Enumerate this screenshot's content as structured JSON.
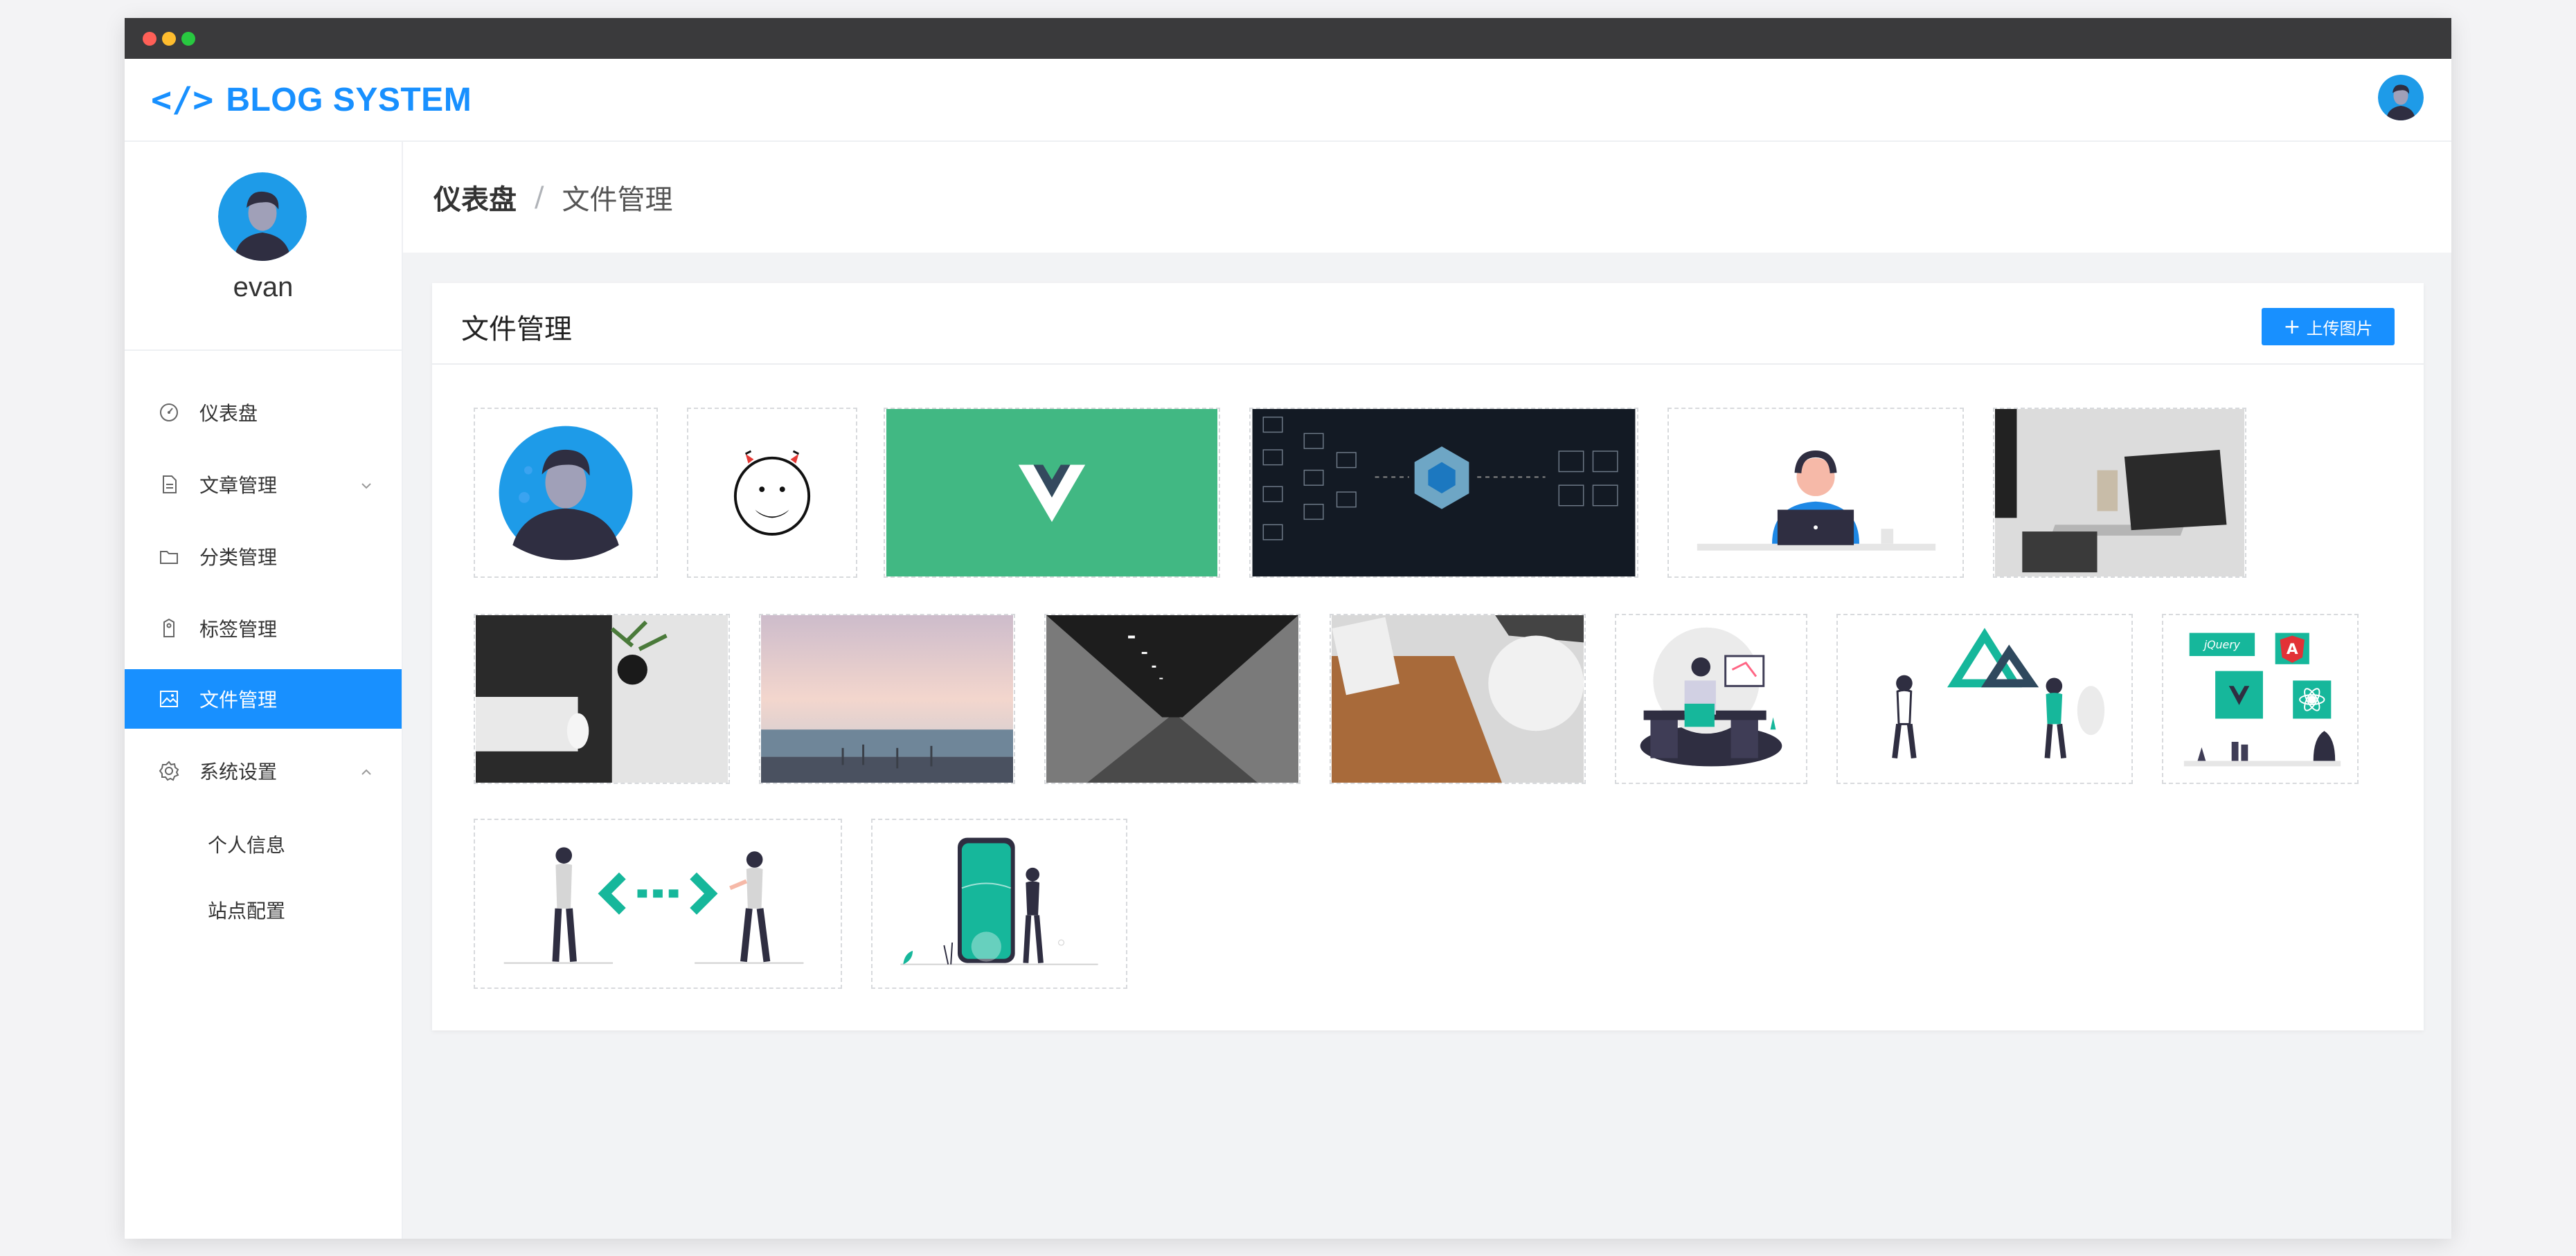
{
  "app": {
    "logo_icon": "</>",
    "title": "BLOG SYSTEM"
  },
  "user": {
    "name": "evan"
  },
  "sidebar": {
    "items": [
      {
        "label": "仪表盘",
        "icon": "dashboard-icon"
      },
      {
        "label": "文章管理",
        "icon": "document-icon",
        "expandable": true,
        "expanded": false
      },
      {
        "label": "分类管理",
        "icon": "folder-icon"
      },
      {
        "label": "标签管理",
        "icon": "tag-icon"
      },
      {
        "label": "文件管理",
        "icon": "image-icon",
        "active": true
      },
      {
        "label": "系统设置",
        "icon": "gear-icon",
        "expandable": true,
        "expanded": true
      }
    ],
    "submenu": [
      "个人信息",
      "站点配置"
    ]
  },
  "breadcrumb": {
    "home": "仪表盘",
    "separator": "/",
    "current": "文件管理"
  },
  "card": {
    "title": "文件管理",
    "upload_label": "上传图片",
    "upload_icon": "plus-icon"
  },
  "files": [
    {
      "name": "avatar-image"
    },
    {
      "name": "doodle-face-image"
    },
    {
      "name": "vue-logo-image"
    },
    {
      "name": "webpack-diagram-image"
    },
    {
      "name": "developer-illustration-image"
    },
    {
      "name": "laptop-desk-photo"
    },
    {
      "name": "keyboard-desk-photo"
    },
    {
      "name": "beach-sunset-photo"
    },
    {
      "name": "tunnel-photo"
    },
    {
      "name": "leather-notebook-photo"
    },
    {
      "name": "coding-desk-illustration"
    },
    {
      "name": "nuxt-team-illustration"
    },
    {
      "name": "frameworks-illustration"
    },
    {
      "name": "code-exchange-illustration"
    },
    {
      "name": "mobile-app-illustration"
    }
  ],
  "colors": {
    "accent": "#1890ff",
    "vue_green": "#41b883",
    "teal": "#16b79b"
  }
}
